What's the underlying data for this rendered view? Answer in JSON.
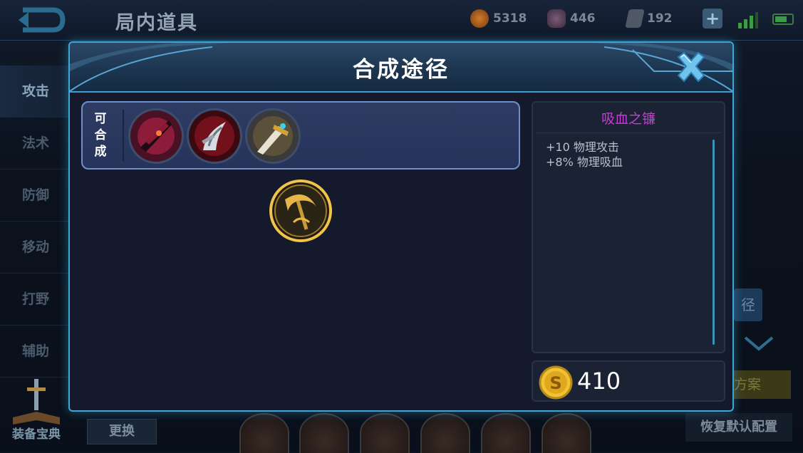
{
  "header": {
    "title": "局内道具",
    "gold": "5318",
    "gems": "446",
    "vouchers": "192"
  },
  "sidebar": {
    "items": [
      {
        "label": "攻击"
      },
      {
        "label": "法术"
      },
      {
        "label": "防御"
      },
      {
        "label": "移动"
      },
      {
        "label": "打野"
      },
      {
        "label": "辅助"
      }
    ],
    "guide_label": "装备宝典"
  },
  "footer": {
    "swap_label": "更换",
    "restore_label": "恢复默认配置",
    "peek_path": "径",
    "peek_plan": "方案"
  },
  "dialog": {
    "title": "合成途径",
    "synth_label": [
      "可",
      "合",
      "成"
    ],
    "synth_items": [
      {
        "icon": "crimson-blade-icon"
      },
      {
        "icon": "silver-claw-blade-icon"
      },
      {
        "icon": "golden-dagger-icon"
      }
    ],
    "selected_item_icon": "golden-scythe-icon",
    "item_name": "吸血之镰",
    "item_name_color": "#c83bd8",
    "stats": [
      "+10 物理攻击",
      "+8% 物理吸血"
    ],
    "price": "410"
  },
  "colors": {
    "border_accent": "#3fa7d6",
    "synth_border": "#6f8fc9"
  }
}
